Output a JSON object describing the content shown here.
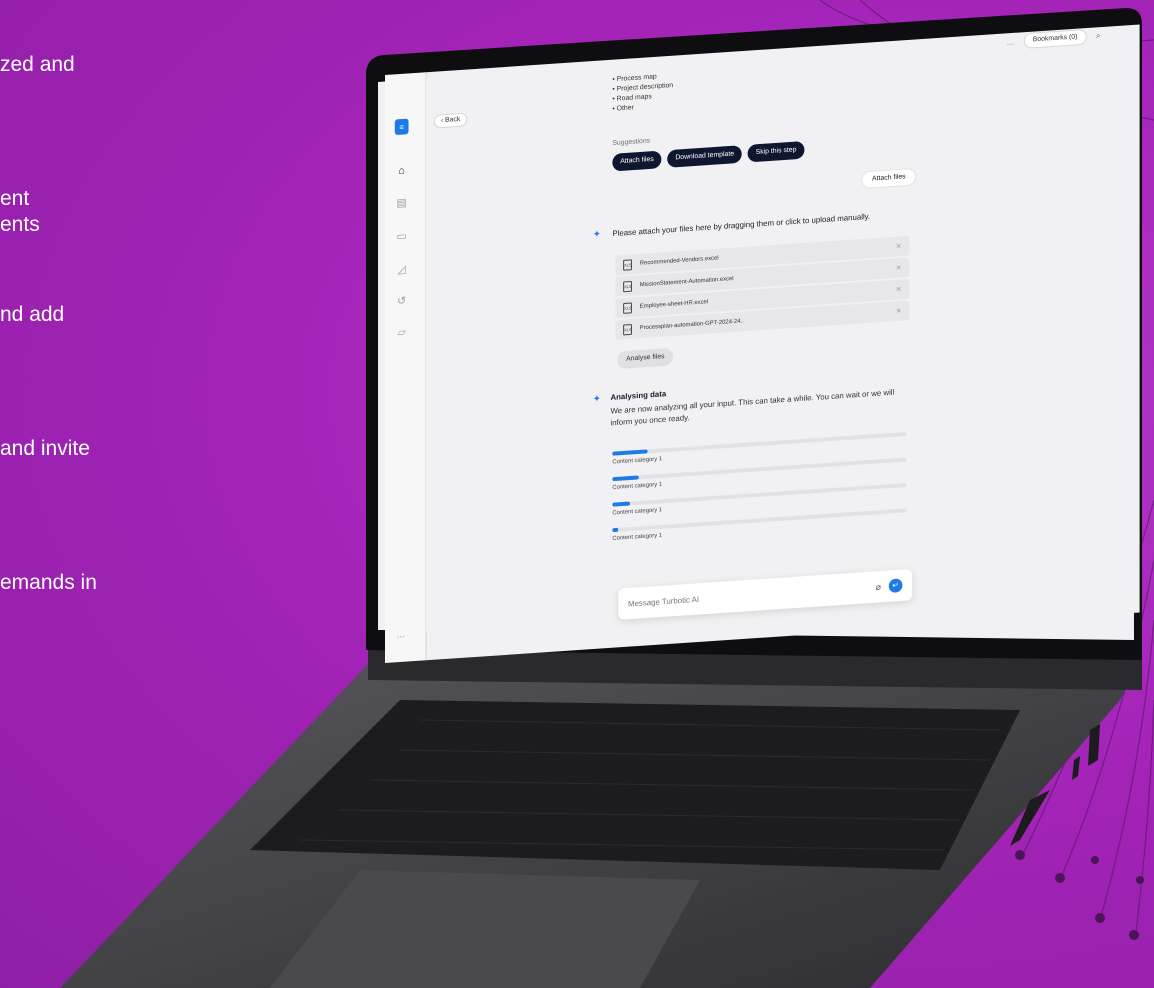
{
  "left_text": [
    "zed and",
    "ent",
    "ents",
    "nd add",
    "and invite",
    "emands in"
  ],
  "app": {
    "header": {
      "back_label": "Back",
      "dots": "...",
      "bookmarks_label": "Bookmarks (0)"
    },
    "sidebar": {
      "icons": [
        "home-icon",
        "document-icon",
        "chat-icon",
        "chart-icon",
        "history-icon",
        "folder-icon"
      ],
      "more": "..."
    },
    "doc_list": [
      "Process map",
      "Project description",
      "Road maps",
      "Other"
    ],
    "suggestions": {
      "label": "Suggestions",
      "chips": [
        "Attach files",
        "Download template",
        "Skip this step"
      ]
    },
    "user_message": "Attach files",
    "upload_prompt": "Please attach your files here by dragging them or click to upload manually.",
    "files": [
      {
        "name": "Recommended-Vendors.excel",
        "ext": "XLS"
      },
      {
        "name": "MissionStatement-Automation.excel",
        "ext": "XLS"
      },
      {
        "name": "Employee-sheet-HR.excel",
        "ext": "XLS"
      },
      {
        "name": "Processplan-automation-GPT-2024-24..",
        "ext": "XLS"
      }
    ],
    "analyse_button": "Analyse files",
    "analysing": {
      "title": "Analysing data",
      "body": "We are now analyzing all your input. This can take a while. You can wait or we will inform you once ready."
    },
    "progress": [
      {
        "label": "Content category 1",
        "value": 0.12
      },
      {
        "label": "Content category 1",
        "value": 0.09
      },
      {
        "label": "Content category 1",
        "value": 0.06
      },
      {
        "label": "Content category 1",
        "value": 0.02
      }
    ],
    "composer": {
      "placeholder": "Message Turbotic AI"
    }
  },
  "colors": {
    "background": "#a524b9",
    "accent": "#1e7ae6",
    "chip_bg": "#0f1630"
  }
}
